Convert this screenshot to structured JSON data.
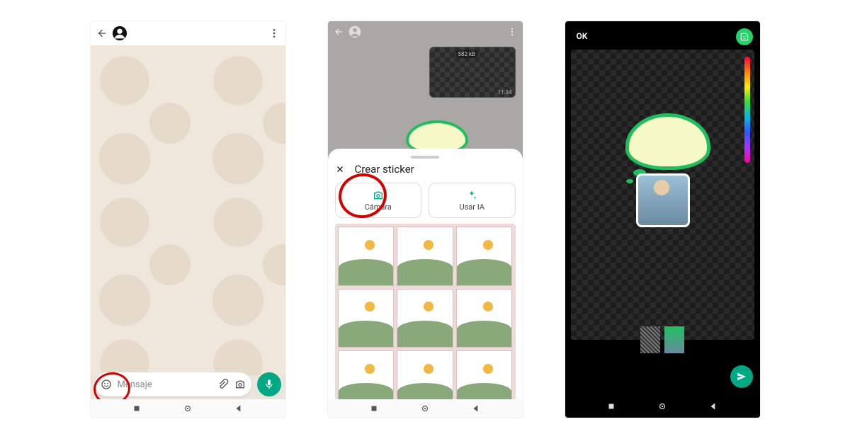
{
  "screen1": {
    "input_placeholder": "Mensaje"
  },
  "screen2": {
    "sheet_title": "Crear sticker",
    "camera_label": "Cámara",
    "ai_label": "Usar IA",
    "media_badge": "582 kB",
    "media_time": "11:34"
  },
  "screen3": {
    "ok_label": "OK"
  }
}
